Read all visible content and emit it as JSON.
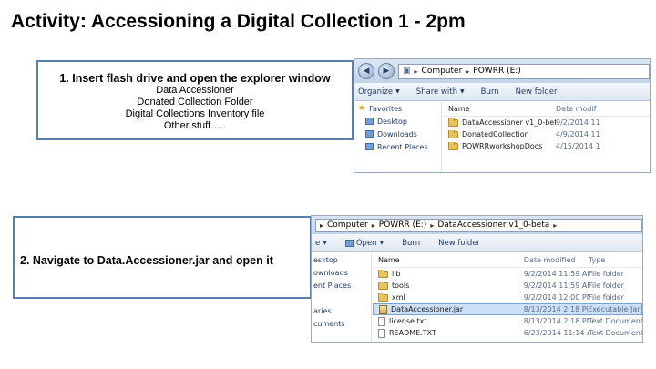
{
  "slide": {
    "title": "Activity: Accessioning a Digital Collection 1 - 2pm"
  },
  "step1": {
    "heading": "1. Insert flash drive and open the explorer window",
    "lines": [
      "Data Accessioner",
      "Donated Collection Folder",
      "Digital Collections Inventory file",
      "Other stuff….."
    ]
  },
  "step2": {
    "heading": "2. Navigate to Data.Accessioner.jar and open it"
  },
  "explorer1": {
    "breadcrumb": [
      "Computer",
      "POWRR (E:)"
    ],
    "toolbar": [
      "Organize",
      "Share with",
      "Burn",
      "New folder"
    ],
    "nav": {
      "favorites": "Favorites",
      "items": [
        "Desktop",
        "Downloads",
        "Recent Places"
      ]
    },
    "columns": {
      "name": "Name",
      "date": "Date modif"
    },
    "files": [
      {
        "name": "DataAccessioner v1_0-beta",
        "date": "9/2/2014 11"
      },
      {
        "name": "DonatedCollection",
        "date": "4/9/2014 11"
      },
      {
        "name": "POWRRworkshopDocs",
        "date": "4/15/2014 1"
      }
    ]
  },
  "explorer2": {
    "breadcrumb": [
      "Computer",
      "POWRR (E:)",
      "DataAccessioner v1_0-beta"
    ],
    "toolbar": [
      "e",
      "Open",
      "Burn",
      "New folder"
    ],
    "nav": [
      "esktop",
      "ownloads",
      "ent Places",
      "",
      "aries",
      "cuments"
    ],
    "columns": {
      "name": "Name",
      "date": "Date modified",
      "type": "Type"
    },
    "files": [
      {
        "name": "lib",
        "date": "9/2/2014 11:59 AM",
        "type": "File folder",
        "kind": "folder"
      },
      {
        "name": "tools",
        "date": "9/2/2014 11:59 AM",
        "type": "File folder",
        "kind": "folder"
      },
      {
        "name": "xml",
        "date": "9/2/2014 12:00 PM",
        "type": "File folder",
        "kind": "folder"
      },
      {
        "name": "DataAccessioner.jar",
        "date": "8/13/2014 2:18 PM",
        "type": "Executable Jar File",
        "kind": "jar",
        "selected": true
      },
      {
        "name": "license.txt",
        "date": "8/13/2014 2:18 PM",
        "type": "Text Document",
        "kind": "file"
      },
      {
        "name": "README.TXT",
        "date": "6/23/2014 11:14 AM",
        "type": "Text Document",
        "kind": "file"
      }
    ]
  }
}
